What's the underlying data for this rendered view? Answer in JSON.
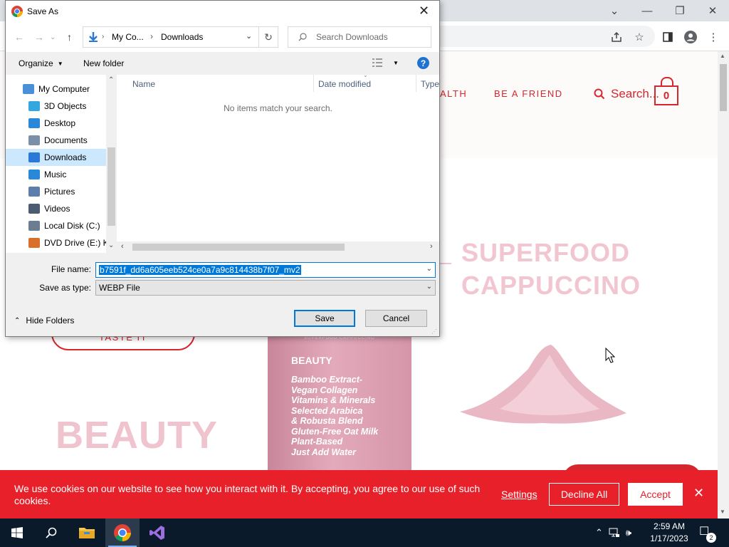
{
  "dialog": {
    "title": "Save As",
    "breadcrumb": [
      "My Co...",
      "Downloads"
    ],
    "search_placeholder": "Search Downloads",
    "organize_label": "Organize",
    "new_folder_label": "New folder",
    "columns": [
      "Name",
      "Date modified",
      "Type"
    ],
    "empty_message": "No items match your search.",
    "sidebar_items": [
      {
        "label": "My Computer",
        "icon": "computer-icon"
      },
      {
        "label": "3D Objects",
        "icon": "cube-icon"
      },
      {
        "label": "Desktop",
        "icon": "desktop-icon"
      },
      {
        "label": "Documents",
        "icon": "document-icon"
      },
      {
        "label": "Downloads",
        "icon": "download-icon"
      },
      {
        "label": "Music",
        "icon": "music-icon"
      },
      {
        "label": "Pictures",
        "icon": "pictures-icon"
      },
      {
        "label": "Videos",
        "icon": "videos-icon"
      },
      {
        "label": "Local Disk (C:)",
        "icon": "disk-icon"
      },
      {
        "label": "DVD Drive (E:) Ko",
        "icon": "dvd-icon"
      }
    ],
    "selected_sidebar_item": "Downloads",
    "file_name_label": "File name:",
    "file_name_value": "b7591f_dd6a605eeb524ce0a7a9c814438b7f07_mv2",
    "save_as_type_label": "Save as type:",
    "save_as_type_value": "WEBP File",
    "save_label": "Save",
    "cancel_label": "Cancel",
    "hide_folders_label": "Hide Folders"
  },
  "page": {
    "nav_partial": "ALTH",
    "nav_friend": "BE A FRIEND",
    "search_label": "Search...",
    "cart_count": "0",
    "hero_line1": "SUPERFOOD",
    "hero_line2": "CAPPUCCINO",
    "beauty_heading": "BEAUTY",
    "taste_button": "TASTE IT",
    "pouch_subtitle": "SUPERFOOD CAPPUCCINO",
    "pouch_title": "BEAUTY",
    "pouch_lines": [
      "Bamboo Extract-",
      "Vegan Collagen",
      "Vitamins & Minerals",
      "Selected Arabica",
      "& Robusta Blend",
      "Gluten-Free Oat Milk",
      "Plant-Based",
      "Just Add Water"
    ]
  },
  "cookie": {
    "text": "We use cookies on our website to see how you interact with it. By accepting, you agree to our use of such cookies.",
    "settings_label": "Settings",
    "decline_label": "Decline All",
    "accept_label": "Accept"
  },
  "taskbar": {
    "time": "2:59 AM",
    "date": "1/17/2023",
    "notification_count": "2"
  },
  "colors": {
    "brand_red": "#d6262e",
    "cookie_red": "#e8202a",
    "hero_pink": "#f2c6d1",
    "selection_blue": "#0078d7"
  }
}
